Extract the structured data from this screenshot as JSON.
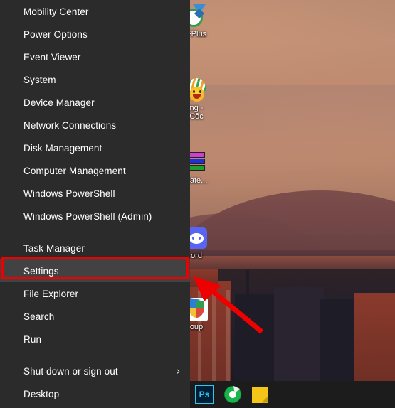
{
  "menu": {
    "name": "Win+X Power User Menu",
    "background_color": "#2b2b2b",
    "hover_color": "#424242",
    "text_color": "#ffffff",
    "items": [
      {
        "label": "Mobility Center",
        "type": "item",
        "hover": false,
        "chevron": ""
      },
      {
        "label": "Power Options",
        "type": "item",
        "hover": false,
        "chevron": ""
      },
      {
        "label": "Event Viewer",
        "type": "item",
        "hover": false,
        "chevron": ""
      },
      {
        "label": "System",
        "type": "item",
        "hover": false,
        "chevron": ""
      },
      {
        "label": "Device Manager",
        "type": "item",
        "hover": false,
        "chevron": ""
      },
      {
        "label": "Network Connections",
        "type": "item",
        "hover": false,
        "chevron": ""
      },
      {
        "label": "Disk Management",
        "type": "item",
        "hover": false,
        "chevron": ""
      },
      {
        "label": "Computer Management",
        "type": "item",
        "hover": false,
        "chevron": ""
      },
      {
        "label": "Windows PowerShell",
        "type": "item",
        "hover": false,
        "chevron": ""
      },
      {
        "label": "Windows PowerShell (Admin)",
        "type": "item",
        "hover": false,
        "chevron": ""
      },
      {
        "label": "",
        "type": "separator",
        "hover": false,
        "chevron": ""
      },
      {
        "label": "Task Manager",
        "type": "item",
        "hover": false,
        "chevron": ""
      },
      {
        "label": "Settings",
        "type": "item",
        "hover": true,
        "chevron": ""
      },
      {
        "label": "File Explorer",
        "type": "item",
        "hover": false,
        "chevron": ""
      },
      {
        "label": "Search",
        "type": "item",
        "hover": false,
        "chevron": ""
      },
      {
        "label": "Run",
        "type": "item",
        "hover": false,
        "chevron": ""
      },
      {
        "label": "",
        "type": "separator",
        "hover": false,
        "chevron": ""
      },
      {
        "label": "Shut down or sign out",
        "type": "item",
        "hover": false,
        "chevron": "›"
      },
      {
        "label": "Desktop",
        "type": "item",
        "hover": false,
        "chevron": ""
      }
    ]
  },
  "annotation": {
    "color": "#ee0000",
    "highlighted_item": "Settings",
    "shapes": [
      "rectangle",
      "arrow"
    ]
  },
  "desktop": {
    "wallpaper_description": "Sunset over mountain and city skyline",
    "icons": [
      {
        "label": "FPlus",
        "icon": "download-manager-icon"
      },
      {
        "label": "ng -\nCốc",
        "icon": "coccoc-browser-icon"
      },
      {
        "label": "date...",
        "icon": "update-icon"
      },
      {
        "label": "ord",
        "icon": "discord-icon"
      },
      {
        "label": "oup",
        "icon": "homegroup-shield-icon"
      }
    ]
  },
  "taskbar": {
    "background_color": "#1c1c1c",
    "items": [
      {
        "label": "Ps",
        "icon": "photoshop-icon"
      },
      {
        "label": "",
        "icon": "disc-burner-icon"
      },
      {
        "label": "",
        "icon": "sticky-notes-icon"
      }
    ]
  }
}
